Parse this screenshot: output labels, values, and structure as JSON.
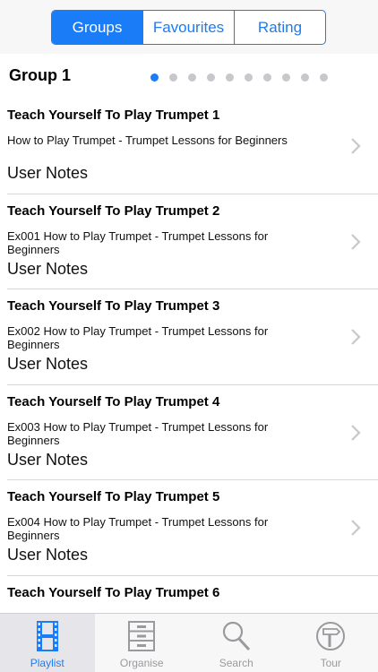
{
  "segments": [
    {
      "label": "Groups",
      "active": true
    },
    {
      "label": "Favourites",
      "active": false
    },
    {
      "label": "Rating",
      "active": false
    }
  ],
  "group": {
    "title": "Group 1",
    "page_count": 10,
    "current_page": 1
  },
  "items": [
    {
      "title": "Teach Yourself To Play Trumpet 1",
      "subtitle": "How to Play Trumpet - Trumpet Lessons for Beginners",
      "notes": "User Notes"
    },
    {
      "title": "Teach Yourself To Play Trumpet 2",
      "subtitle": "Ex001 How to Play Trumpet - Trumpet Lessons for Beginners",
      "notes": "User Notes"
    },
    {
      "title": "Teach Yourself To Play Trumpet 3",
      "subtitle": "Ex002 How to Play Trumpet - Trumpet Lessons for Beginners",
      "notes": "User Notes"
    },
    {
      "title": "Teach Yourself To Play Trumpet 4",
      "subtitle": "Ex003 How to Play Trumpet - Trumpet Lessons for Beginners",
      "notes": "User Notes"
    },
    {
      "title": "Teach Yourself To Play Trumpet 5",
      "subtitle": "Ex004 How to Play Trumpet - Trumpet Lessons for Beginners",
      "notes": "User Notes"
    },
    {
      "title": "Teach Yourself To Play Trumpet 6",
      "subtitle": "",
      "notes": ""
    }
  ],
  "tabs": [
    {
      "label": "Playlist",
      "icon": "film-strip-icon",
      "active": true
    },
    {
      "label": "Organise",
      "icon": "cabinet-icon",
      "active": false
    },
    {
      "label": "Search",
      "icon": "magnifier-icon",
      "active": false
    },
    {
      "label": "Tour",
      "icon": "signpost-icon",
      "active": false
    }
  ],
  "colors": {
    "accent": "#1a7cf6",
    "inactive_icon": "#9a9a9e",
    "separator": "#d8d8dc"
  }
}
